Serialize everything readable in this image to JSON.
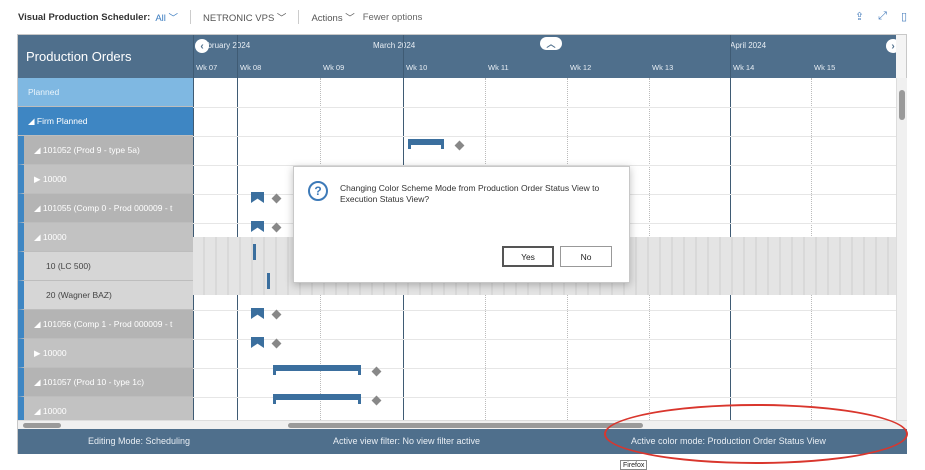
{
  "topbar": {
    "title": "Visual Production Scheduler:",
    "filter": "All",
    "menu_netronic": "NETRONIC VPS",
    "menu_actions": "Actions",
    "fewer": "Fewer options"
  },
  "left": {
    "header": "Production Orders",
    "rows": [
      {
        "label": "Planned"
      },
      {
        "label": "Firm Planned"
      },
      {
        "label": "101052 (Prod 9 - type 5a)"
      },
      {
        "label": "10000"
      },
      {
        "label": "101055 (Comp 0 - Prod 000009 - t"
      },
      {
        "label": "10000"
      },
      {
        "label": "10 (LC 500)"
      },
      {
        "label": "20 (Wagner BAZ)"
      },
      {
        "label": "101056 (Comp 1 - Prod 000009 - t"
      },
      {
        "label": "10000"
      },
      {
        "label": "101057 (Prod 10 - type 1c)"
      },
      {
        "label": "10000"
      }
    ]
  },
  "timeline": {
    "months": [
      "ebruary 2024",
      "March 2024",
      "April 2024"
    ],
    "weeks": [
      "Wk 07",
      "Wk 08",
      "Wk 09",
      "Wk 10",
      "Wk 11",
      "Wk 12",
      "Wk 13",
      "Wk 14",
      "Wk 15"
    ]
  },
  "dialog": {
    "message": "Changing Color Scheme Mode from Production Order Status View to Execution Status View?",
    "yes": "Yes",
    "no": "No"
  },
  "status": {
    "editing": "Editing Mode:  Scheduling",
    "filter": "Active view filter:  No view filter active",
    "color": "Active color mode:  Production Order Status View"
  },
  "tooltip": "Firefox",
  "colors": {
    "header": "#4f6f8c",
    "accent": "#3e86c3",
    "highlight": "#d9362d"
  }
}
